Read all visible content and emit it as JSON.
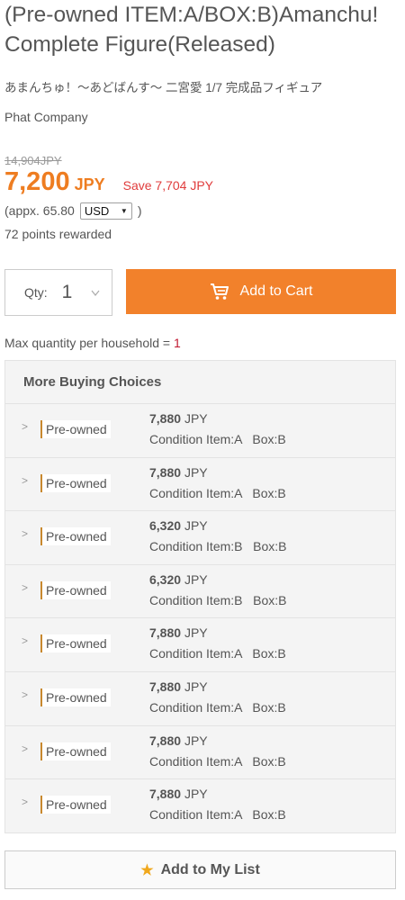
{
  "product": {
    "title_line1": "(Pre-owned ITEM:A/BOX:B)Amanchu! ",
    "title_line2": "Complete Figure(Released)",
    "japanese_name": "あまんちゅ！～あどばんす～ 二宮愛 1/7 完成品フィギュア",
    "maker": "Phat Company"
  },
  "pricing": {
    "old_price": "14,904JPY",
    "price": "7,200",
    "currency": "JPY",
    "save_text": "Save 7,704 JPY",
    "approx_prefix": "(appx. 65.80",
    "approx_suffix": ")",
    "currency_selected": "USD",
    "points_text": "72 points rewarded"
  },
  "purchase": {
    "qty_label": "Qty:",
    "qty_value": "1",
    "add_to_cart_label": "Add to Cart",
    "max_qty_prefix": "Max quantity per household = ",
    "max_qty_value": "1"
  },
  "more_choices": {
    "heading": "More Buying Choices",
    "items": [
      {
        "tag": "Pre-owned",
        "price": "7,880",
        "currency": "JPY",
        "condition": "Condition Item:A   Box:B"
      },
      {
        "tag": "Pre-owned",
        "price": "7,880",
        "currency": "JPY",
        "condition": "Condition Item:A   Box:B"
      },
      {
        "tag": "Pre-owned",
        "price": "6,320",
        "currency": "JPY",
        "condition": "Condition Item:B   Box:B"
      },
      {
        "tag": "Pre-owned",
        "price": "6,320",
        "currency": "JPY",
        "condition": "Condition Item:B   Box:B"
      },
      {
        "tag": "Pre-owned",
        "price": "7,880",
        "currency": "JPY",
        "condition": "Condition Item:A   Box:B"
      },
      {
        "tag": "Pre-owned",
        "price": "7,880",
        "currency": "JPY",
        "condition": "Condition Item:A   Box:B"
      },
      {
        "tag": "Pre-owned",
        "price": "7,880",
        "currency": "JPY",
        "condition": "Condition Item:A   Box:B"
      },
      {
        "tag": "Pre-owned",
        "price": "7,880",
        "currency": "JPY",
        "condition": "Condition Item:A   Box:B"
      }
    ]
  },
  "my_list": {
    "label": "Add to My List",
    "icon": "star-icon"
  },
  "colors": {
    "accent": "#f2812b",
    "price": "#ee7d21",
    "save": "#e03c3c",
    "star": "#f0a81d"
  }
}
